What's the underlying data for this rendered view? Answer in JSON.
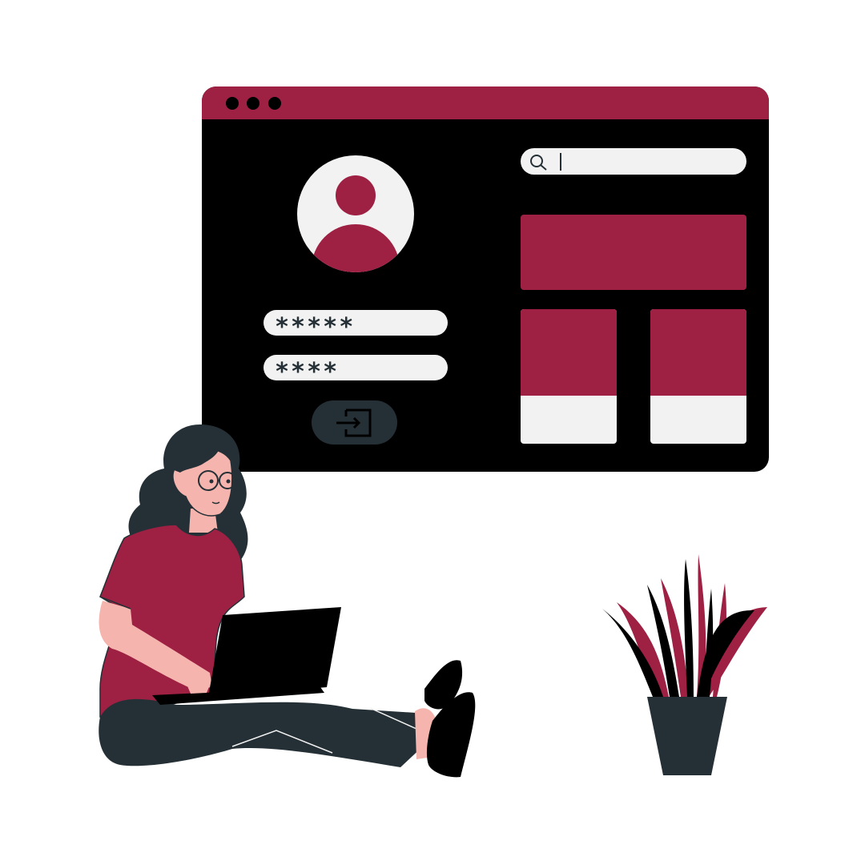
{
  "window": {
    "colors": {
      "accent": "#9e2043",
      "background": "#000000",
      "light": "#f2f2f2",
      "dark": "#253036"
    }
  },
  "login": {
    "password_field_1": "*****",
    "password_field_2": "****",
    "login_icon": "login-arrow-icon"
  },
  "search": {
    "icon": "search-icon",
    "value": ""
  },
  "content": {
    "banner": "banner-block",
    "cards": [
      "card",
      "card"
    ]
  }
}
